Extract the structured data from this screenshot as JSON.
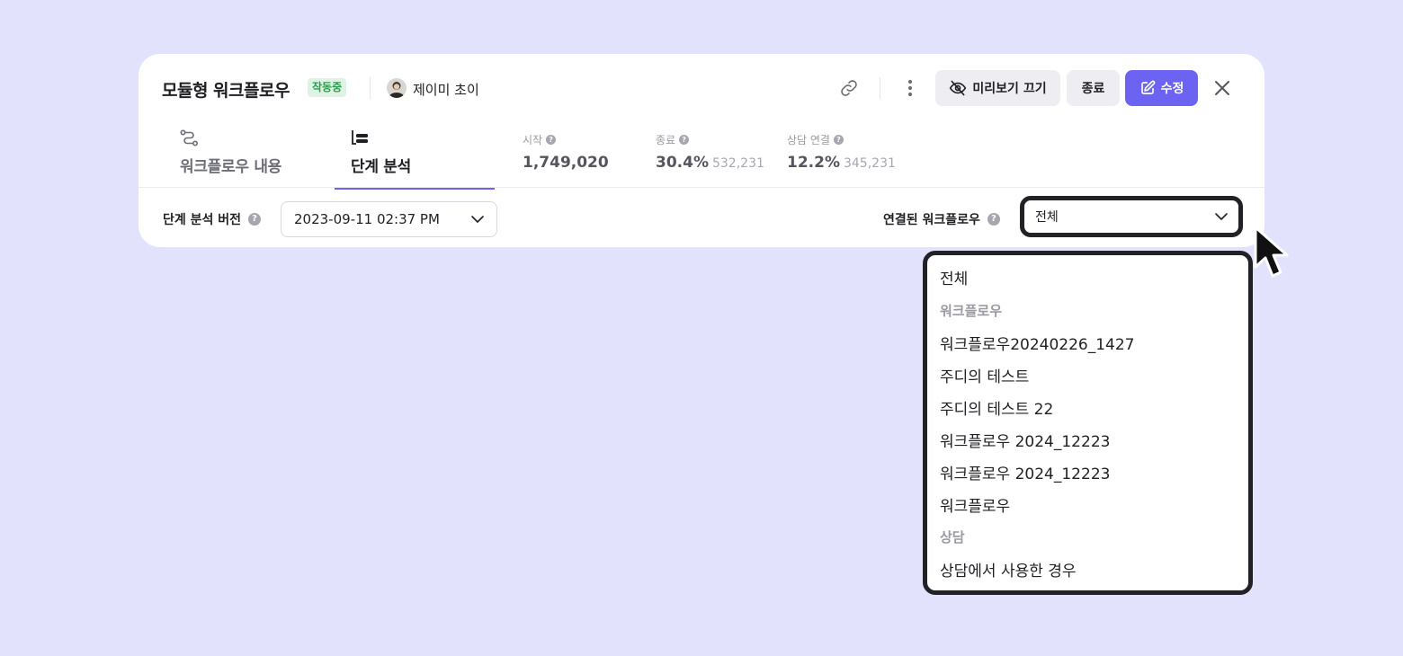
{
  "header": {
    "title": "모듈형 워크플로우",
    "status_badge": "작동중",
    "owner": "제이미 초이",
    "preview_off_label": "미리보기 끄기",
    "end_label": "종료",
    "edit_label": "수정"
  },
  "tabs": [
    {
      "label": "워크플로우 내용",
      "icon": "workflow-route-icon",
      "active": false
    },
    {
      "label": "단계 분석",
      "icon": "step-tree-icon",
      "active": true
    }
  ],
  "stats": [
    {
      "label": "시작",
      "value": "1,749,020",
      "sub": ""
    },
    {
      "label": "종료",
      "value": "30.4%",
      "sub": "532,231"
    },
    {
      "label": "상담 연결",
      "value": "12.2%",
      "sub": "345,231"
    }
  ],
  "filters": {
    "version_label": "단계 분석 버전",
    "version_value": "2023-09-11 02:37 PM",
    "linked_label": "연결된 워크플로우",
    "linked_value": "전체"
  },
  "dropdown": {
    "all": "전체",
    "group_workflow": "워크플로우",
    "workflow_items": [
      "워크플로우20240226_1427",
      "주디의 테스트",
      "주디의 테스트 22",
      "워크플로우 2024_12223",
      "워크플로우 2024_12223",
      "워크플로우"
    ],
    "group_consult": "상담",
    "consult_items": [
      "상담에서 사용한 경우"
    ]
  },
  "colors": {
    "background": "#e3e2fd",
    "accent": "#6c63f2",
    "badge_bg": "#dff3e4",
    "badge_text": "#2d9b4d"
  }
}
